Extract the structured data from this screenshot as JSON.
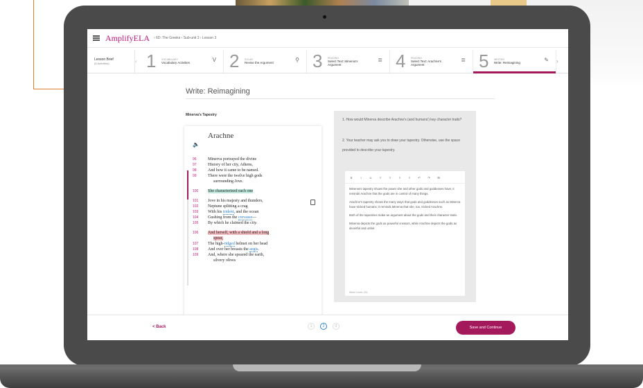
{
  "header": {
    "brand_main": "Amplify",
    "brand_suffix": "ELA",
    "breadcrumb": "›  6D: The Greeks  ›  Sub-unit 3  ›  Lesson 3"
  },
  "lesson_brief": {
    "label": "Lesson Brief",
    "sub": "(6 Activities)"
  },
  "steps": [
    {
      "num": "1",
      "kind": "VOCABULARY",
      "name": "Vocabulary Activities",
      "icon": "V"
    },
    {
      "num": "2",
      "kind": "SOLAR",
      "name": "Revise the Argument",
      "icon": "⚲"
    },
    {
      "num": "3",
      "kind": "READING",
      "name": "Select Text: Minerva's Argument",
      "icon": "≣"
    },
    {
      "num": "4",
      "kind": "READING",
      "name": "Select Text: Arachne's Argument",
      "icon": "≣"
    },
    {
      "num": "5",
      "kind": "WRITING",
      "name": "Write: Reimagining",
      "icon": "✎"
    }
  ],
  "main": {
    "page_title": "Write: Reimagining",
    "story_title": "Minerva's Tapestry",
    "poem_title": "Arachne"
  },
  "poem_lines": [
    {
      "n": "96",
      "text": "Minerva portrayed the divine"
    },
    {
      "n": "97",
      "text": "History of her city, Athens,"
    },
    {
      "n": "98",
      "text": "And how it came to be named."
    },
    {
      "n": "99",
      "text": "There were the twelve high gods"
    },
    {
      "n": "",
      "text": "surrounding Jove."
    },
    {
      "n": "100",
      "pre": "",
      "hl": "She characterized each one",
      "post": ""
    },
    {
      "n": "101",
      "text": "Jove in his majesty and thunders,"
    },
    {
      "n": "102",
      "text": "Neptune splitting a crag"
    },
    {
      "n": "103",
      "pre": "With his ",
      "link": "trident",
      "post": ", and the ocean"
    },
    {
      "n": "104",
      "pre": "Gushing from the ",
      "link": "crevasse",
      "post": "—"
    },
    {
      "n": "105",
      "text": "By which he claimed the city."
    },
    {
      "n": "106",
      "hl2": "And herself, with a shield and a long"
    },
    {
      "n": "",
      "hl2": "spear,"
    },
    {
      "n": "107",
      "pre": "The high-",
      "link": "ridged",
      "post": " helmet on her head"
    },
    {
      "n": "108",
      "pre": "And over her breasts the ",
      "link": "aegis",
      "post": "."
    },
    {
      "n": "109",
      "text": "And, where she speared the earth,"
    },
    {
      "n": "",
      "text": "silvery olives"
    }
  ],
  "questions": {
    "q1": "1. How would Minerva describe Arachne's (and humans') key character traits?",
    "q2": "2. Your teacher may ask you to draw your tapestry. Otherwise, use the space provided to describe your tapestry."
  },
  "editor": {
    "toolbar": [
      "B",
      "I",
      "U",
      "≡",
      "≡",
      "≡",
      "≡",
      "↶",
      "↷",
      "⊞"
    ],
    "paragraphs": [
      "Minerva's tapestry shows the power she and other gods and goddesses have; it reminds Arachne that the gods are in control of many things.",
      "Arachne's tapestry shows the many ways that gods and goddesses such as Minerva have tricked humans; it reminds Minerva that she, too, tricked Arachne.",
      "Both of the tapestries make an argument about the gods and their character traits.",
      "Minerva depicts the gods as powerful creators, while Arachne depicts the gods as deceitful and unfair."
    ],
    "word_count": "Word Count: 124"
  },
  "footer": {
    "back_label": "< Back",
    "pages": [
      "1",
      "2",
      "3"
    ],
    "current_page_index": 1,
    "save_label": "Save and Continue"
  },
  "colors": {
    "accent": "#a4185c",
    "brand": "#c4177b",
    "link": "#2c7fd0",
    "callout": "#e87a2a",
    "laptop": "#4a4a4a"
  },
  "reading_progress": 0.25
}
